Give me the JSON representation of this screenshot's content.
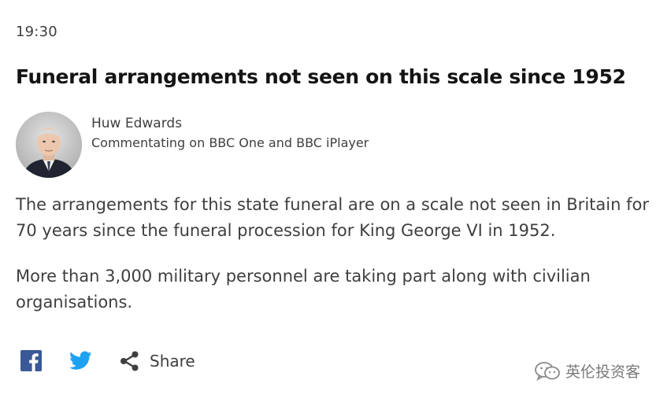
{
  "post": {
    "time": "19:30",
    "headline": "Funeral arrangements not seen on this scale since 1952",
    "author": {
      "name": "Huw Edwards",
      "role": "Commentating on BBC One and BBC iPlayer"
    },
    "paragraphs": [
      "The arrangements for this state funeral are on a scale not seen in Britain for 70 years since the funeral procession for King George VI in 1952.",
      "More than 3,000 military personnel are taking part along with civilian organisations."
    ]
  },
  "share": {
    "icons": [
      "facebook-icon",
      "twitter-icon",
      "share-icon"
    ],
    "label": "Share"
  },
  "watermark": {
    "text": "英伦投资客"
  },
  "colors": {
    "text": "#3f3f42",
    "headline": "#141414",
    "facebook": "#3b5998",
    "twitter": "#1da1f2"
  }
}
